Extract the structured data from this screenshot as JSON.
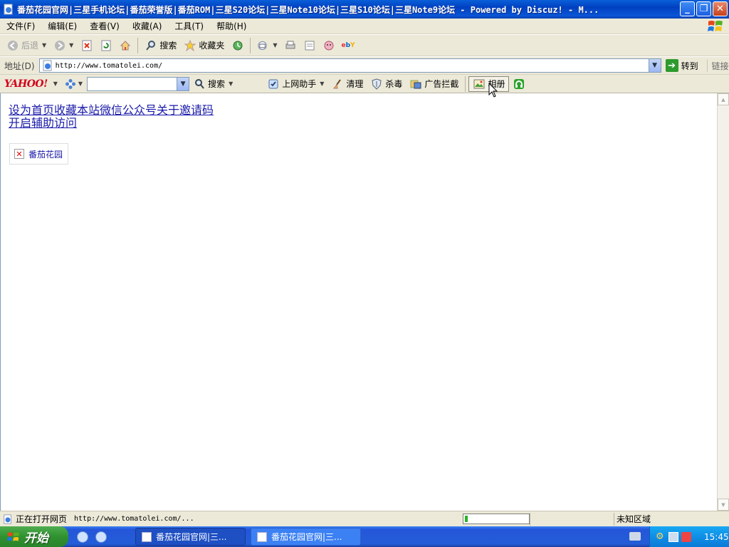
{
  "window": {
    "title": "番茄花园官网|三星手机论坛|番茄荣誉版|番茄ROM|三星S20论坛|三星Note10论坛|三星S10论坛|三星Note9论坛 - Powered by Discuz! - M..."
  },
  "menu": {
    "items": [
      "文件(F)",
      "编辑(E)",
      "查看(V)",
      "收藏(A)",
      "工具(T)",
      "帮助(H)"
    ]
  },
  "toolbar": {
    "back_label": "后退",
    "search_label": "搜索",
    "favorites_label": "收藏夹"
  },
  "address": {
    "label": "地址(D)",
    "url": "http://www.tomatolei.com/",
    "go_label": "转到",
    "links_label": "链接"
  },
  "yahoo": {
    "logo": "YAHOO!",
    "search_value": "",
    "search_label": "搜索",
    "assistant_label": "上网助手",
    "clean_label": "清理",
    "antivirus_label": "杀毒",
    "adblock_label": "广告拦截",
    "album_label": "相册"
  },
  "page": {
    "links_row1": [
      "设为首页",
      "收藏本站",
      "微信公众号",
      "关于邀请码"
    ],
    "links_row2": [
      "开启辅助访问"
    ],
    "broken_image_alt": "番茄花园"
  },
  "status": {
    "text": "正在打开网页",
    "url": "http://www.tomatolei.com/...",
    "progress": 0.05,
    "zone": "未知区域"
  },
  "taskbar": {
    "start_label": "开始",
    "tasks": [
      "番茄花园官网|三...",
      "番茄花园官网|三..."
    ],
    "clock": "15:45"
  }
}
